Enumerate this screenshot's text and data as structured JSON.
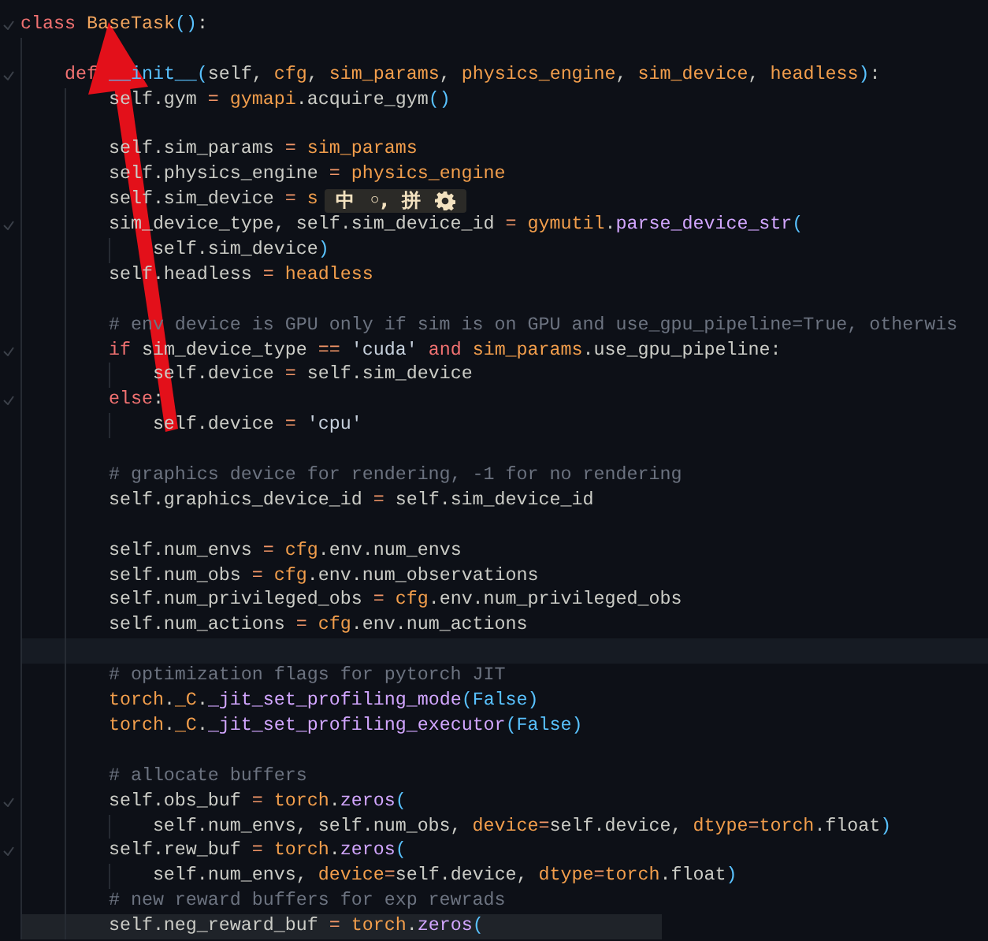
{
  "editor": {
    "lines": [
      {
        "fold": true,
        "tokens": [
          {
            "kind": "kw",
            "text": "class"
          },
          {
            "kind": "cls",
            "text": " BaseTask"
          },
          {
            "kind": "punc",
            "text": "()"
          },
          {
            "kind": "plain",
            "text": ":"
          }
        ]
      },
      {
        "fold": false
      },
      {
        "fold": true,
        "tokens": [
          {
            "kind": "kw",
            "text": "    def"
          },
          {
            "kind": "punc",
            "text": " __init__("
          },
          {
            "kind": "plain",
            "text": "self, "
          },
          {
            "kind": "param",
            "text": "cfg"
          },
          {
            "kind": "plain",
            "text": ", "
          },
          {
            "kind": "param",
            "text": "sim_params"
          },
          {
            "kind": "plain",
            "text": ", "
          },
          {
            "kind": "param",
            "text": "physics_engine"
          },
          {
            "kind": "plain",
            "text": ", "
          },
          {
            "kind": "param",
            "text": "sim_device"
          },
          {
            "kind": "plain",
            "text": ", "
          },
          {
            "kind": "param",
            "text": "headless"
          },
          {
            "kind": "punc",
            "text": ")"
          },
          {
            "kind": "plain",
            "text": ":"
          }
        ]
      },
      {
        "fold": false,
        "tokens": [
          {
            "kind": "plain",
            "text": "        self.gym "
          },
          {
            "kind": "op",
            "text": "="
          },
          {
            "kind": "param",
            "text": " gymapi"
          },
          {
            "kind": "plain",
            "text": ".acquire_gym"
          },
          {
            "kind": "punc",
            "text": "()"
          }
        ]
      },
      {
        "fold": false
      },
      {
        "fold": false,
        "tokens": [
          {
            "kind": "plain",
            "text": "        self.sim_params "
          },
          {
            "kind": "op",
            "text": "="
          },
          {
            "kind": "param",
            "text": " sim_params"
          }
        ]
      },
      {
        "fold": false,
        "tokens": [
          {
            "kind": "plain",
            "text": "        self.physics_engine "
          },
          {
            "kind": "op",
            "text": "="
          },
          {
            "kind": "param",
            "text": " physics_engine"
          }
        ]
      },
      {
        "fold": false,
        "tokens": [
          {
            "kind": "plain",
            "text": "        self.sim_device "
          },
          {
            "kind": "op",
            "text": "="
          },
          {
            "kind": "param",
            "text": " s"
          }
        ]
      },
      {
        "fold": true,
        "tokens": [
          {
            "kind": "plain",
            "text": "        sim_device_type, self.sim_device_id "
          },
          {
            "kind": "op",
            "text": "="
          },
          {
            "kind": "param",
            "text": " gymutil"
          },
          {
            "kind": "plain",
            "text": "."
          },
          {
            "kind": "fn",
            "text": "parse_device_str"
          },
          {
            "kind": "punc",
            "text": "("
          }
        ]
      },
      {
        "fold": false,
        "tokens": [
          {
            "kind": "plain",
            "text": "            self.sim_device"
          },
          {
            "kind": "punc",
            "text": ")"
          }
        ]
      },
      {
        "fold": false,
        "tokens": [
          {
            "kind": "plain",
            "text": "        self.headless "
          },
          {
            "kind": "op",
            "text": "="
          },
          {
            "kind": "param",
            "text": " headless"
          }
        ]
      },
      {
        "fold": false
      },
      {
        "fold": false,
        "tokens": [
          {
            "kind": "comment",
            "text": "        # env device is GPU only if sim is on GPU and use_gpu_pipeline=True, otherwis"
          }
        ]
      },
      {
        "fold": true,
        "tokens": [
          {
            "kind": "kw",
            "text": "        if"
          },
          {
            "kind": "plain",
            "text": " sim_device_type "
          },
          {
            "kind": "op",
            "text": "=="
          },
          {
            "kind": "str",
            "text": " 'cuda'"
          },
          {
            "kind": "kw",
            "text": " and"
          },
          {
            "kind": "param",
            "text": " sim_params"
          },
          {
            "kind": "plain",
            "text": ".use_gpu_pipeline:"
          }
        ]
      },
      {
        "fold": false,
        "tokens": [
          {
            "kind": "plain",
            "text": "            self.device "
          },
          {
            "kind": "op",
            "text": "="
          },
          {
            "kind": "plain",
            "text": " self.sim_device"
          }
        ]
      },
      {
        "fold": true,
        "tokens": [
          {
            "kind": "kw",
            "text": "        else"
          },
          {
            "kind": "plain",
            "text": ":"
          }
        ]
      },
      {
        "fold": false,
        "tokens": [
          {
            "kind": "plain",
            "text": "            self.device "
          },
          {
            "kind": "op",
            "text": "="
          },
          {
            "kind": "str",
            "text": " 'cpu'"
          }
        ]
      },
      {
        "fold": false
      },
      {
        "fold": false,
        "tokens": [
          {
            "kind": "comment",
            "text": "        # graphics device for rendering, -1 for no rendering"
          }
        ]
      },
      {
        "fold": false,
        "tokens": [
          {
            "kind": "plain",
            "text": "        self.graphics_device_id "
          },
          {
            "kind": "op",
            "text": "="
          },
          {
            "kind": "plain",
            "text": " self.sim_device_id"
          }
        ]
      },
      {
        "fold": false
      },
      {
        "fold": false,
        "tokens": [
          {
            "kind": "plain",
            "text": "        self.num_envs "
          },
          {
            "kind": "op",
            "text": "="
          },
          {
            "kind": "param",
            "text": " cfg"
          },
          {
            "kind": "plain",
            "text": ".env.num_envs"
          }
        ]
      },
      {
        "fold": false,
        "tokens": [
          {
            "kind": "plain",
            "text": "        self.num_obs "
          },
          {
            "kind": "op",
            "text": "="
          },
          {
            "kind": "param",
            "text": " cfg"
          },
          {
            "kind": "plain",
            "text": ".env.num_observations"
          }
        ]
      },
      {
        "fold": false,
        "tokens": [
          {
            "kind": "plain",
            "text": "        self.num_privileged_obs "
          },
          {
            "kind": "op",
            "text": "="
          },
          {
            "kind": "param",
            "text": " cfg"
          },
          {
            "kind": "plain",
            "text": ".env.num_privileged_obs"
          }
        ]
      },
      {
        "fold": false,
        "tokens": [
          {
            "kind": "plain",
            "text": "        self.num_actions "
          },
          {
            "kind": "op",
            "text": "="
          },
          {
            "kind": "param",
            "text": " cfg"
          },
          {
            "kind": "plain",
            "text": ".env.num_actions"
          }
        ]
      },
      {
        "fold": false,
        "highlighted": true
      },
      {
        "fold": false,
        "tokens": [
          {
            "kind": "comment",
            "text": "        # optimization flags for pytorch JIT"
          }
        ]
      },
      {
        "fold": false,
        "tokens": [
          {
            "kind": "param",
            "text": "        torch"
          },
          {
            "kind": "plain",
            "text": "."
          },
          {
            "kind": "param",
            "text": "_C"
          },
          {
            "kind": "plain",
            "text": "."
          },
          {
            "kind": "fn",
            "text": "_jit_set_profiling_mode"
          },
          {
            "kind": "punc",
            "text": "(False)"
          }
        ]
      },
      {
        "fold": false,
        "tokens": [
          {
            "kind": "param",
            "text": "        torch"
          },
          {
            "kind": "plain",
            "text": "."
          },
          {
            "kind": "param",
            "text": "_C"
          },
          {
            "kind": "plain",
            "text": "."
          },
          {
            "kind": "fn",
            "text": "_jit_set_profiling_executor"
          },
          {
            "kind": "punc",
            "text": "(False)"
          }
        ]
      },
      {
        "fold": false
      },
      {
        "fold": false,
        "tokens": [
          {
            "kind": "comment",
            "text": "        # allocate buffers"
          }
        ]
      },
      {
        "fold": true,
        "tokens": [
          {
            "kind": "plain",
            "text": "        self.obs_buf "
          },
          {
            "kind": "op",
            "text": "="
          },
          {
            "kind": "param",
            "text": " torch"
          },
          {
            "kind": "plain",
            "text": "."
          },
          {
            "kind": "fn",
            "text": "zeros"
          },
          {
            "kind": "punc",
            "text": "("
          }
        ]
      },
      {
        "fold": false,
        "tokens": [
          {
            "kind": "plain",
            "text": "            self.num_envs, self.num_obs, "
          },
          {
            "kind": "param",
            "text": "device"
          },
          {
            "kind": "op",
            "text": "="
          },
          {
            "kind": "plain",
            "text": "self.device, "
          },
          {
            "kind": "param",
            "text": "dtype"
          },
          {
            "kind": "op",
            "text": "="
          },
          {
            "kind": "param",
            "text": "torch"
          },
          {
            "kind": "plain",
            "text": ".float"
          },
          {
            "kind": "punc",
            "text": ")"
          }
        ]
      },
      {
        "fold": true,
        "tokens": [
          {
            "kind": "plain",
            "text": "        self.rew_buf "
          },
          {
            "kind": "op",
            "text": "="
          },
          {
            "kind": "param",
            "text": " torch"
          },
          {
            "kind": "plain",
            "text": "."
          },
          {
            "kind": "fn",
            "text": "zeros"
          },
          {
            "kind": "punc",
            "text": "("
          }
        ]
      },
      {
        "fold": false,
        "tokens": [
          {
            "kind": "plain",
            "text": "            self.num_envs, "
          },
          {
            "kind": "param",
            "text": "device"
          },
          {
            "kind": "op",
            "text": "="
          },
          {
            "kind": "plain",
            "text": "self.device, "
          },
          {
            "kind": "param",
            "text": "dtype"
          },
          {
            "kind": "op",
            "text": "="
          },
          {
            "kind": "param",
            "text": "torch"
          },
          {
            "kind": "plain",
            "text": ".float"
          },
          {
            "kind": "punc",
            "text": ")"
          }
        ]
      },
      {
        "fold": false,
        "tokens": [
          {
            "kind": "comment",
            "text": "        # new reward buffers for exp rewrads"
          }
        ]
      },
      {
        "fold": false,
        "highlighted": true,
        "tokens": [
          {
            "kind": "plain",
            "text": "        self.neg_reward_buf "
          },
          {
            "kind": "op",
            "text": "="
          },
          {
            "kind": "param",
            "text": " torch"
          },
          {
            "kind": "plain",
            "text": "."
          },
          {
            "kind": "fn",
            "text": "zeros"
          },
          {
            "kind": "punc",
            "text": "("
          }
        ]
      }
    ]
  },
  "ime_toolbar": {
    "mode": "中",
    "punctuation": "◦,",
    "input_method": "拼"
  }
}
